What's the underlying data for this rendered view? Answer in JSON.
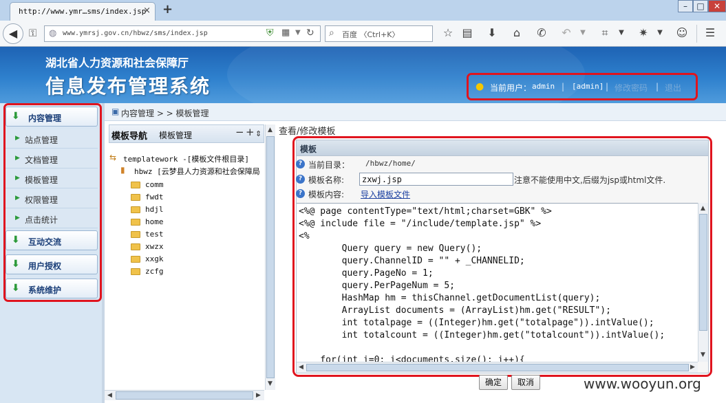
{
  "browser": {
    "tab_title": "http://www.ymr…sms/index.jsp",
    "tab_close": "×",
    "new_tab": "+",
    "url": "www.ymrsj.gov.cn/hbwz/sms/index.jsp",
    "search_placeholder": "百度 〈Ctrl+K〉",
    "window_min": "–",
    "window_max": "□",
    "window_close": "✕"
  },
  "header": {
    "org_name": "湖北省人力资源和社会保障厅",
    "system_title": "信息发布管理系统",
    "user_label": "当前用户：",
    "user_name": "admin",
    "user_role": "[admin]",
    "change_password": "修改密码",
    "logout": "退出",
    "separator": "|"
  },
  "sidebar": {
    "sections": [
      {
        "label": "内容管理",
        "items": [
          "站点管理",
          "文档管理",
          "模板管理",
          "权限管理",
          "点击统计"
        ]
      },
      {
        "label": "互动交流",
        "items": []
      },
      {
        "label": "用户授权",
        "items": []
      },
      {
        "label": "系统维护",
        "items": []
      }
    ]
  },
  "breadcrumb": {
    "text": "内容管理 > > 模板管理"
  },
  "template_nav": {
    "title": "模板导航",
    "tab": "模板管理",
    "collapse": "−",
    "expand": "+",
    "refresh": "⇕",
    "root": "templatework -[模板文件根目录]",
    "site": "hbwz [云梦县人力资源和社会保障局",
    "folders": [
      "comm",
      "fwdt",
      "hdjl",
      "home",
      "test",
      "xwzx",
      "xxgk",
      "zcfg"
    ]
  },
  "main": {
    "view_title": "查看/修改模板",
    "panel_title": "模板",
    "current_dir_label": "当前目录：",
    "current_dir_value": "/hbwz/home/",
    "template_name_label": "模板名称:",
    "template_name_value": "zxwj.jsp",
    "template_name_hint": "注意不能使用中文,后缀为jsp或html文件.",
    "template_content_label": "模板内容:",
    "import_link": "导入模板文件",
    "code": "<%@ page contentType=\"text/html;charset=GBK\" %>\n<%@ include file = \"/include/template.jsp\" %>\n<%\n        Query query = new Query();\n        query.ChannelID = \"\" + _CHANNELID;\n        query.PageNo = 1;\n        query.PerPageNum = 5;\n        HashMap hm = thisChannel.getDocumentList(query);\n        ArrayList documents = (ArrayList)hm.get(\"RESULT\");\n        int totalpage = ((Integer)hm.get(\"totalpage\")).intValue();\n        int totalcount = ((Integer)hm.get(\"totalcount\")).intValue();\n\n    for(int i=0; i<documents.size(); i++){",
    "ok_button": "确定",
    "cancel_button": "取消"
  },
  "watermark": "www.wooyun.org"
}
